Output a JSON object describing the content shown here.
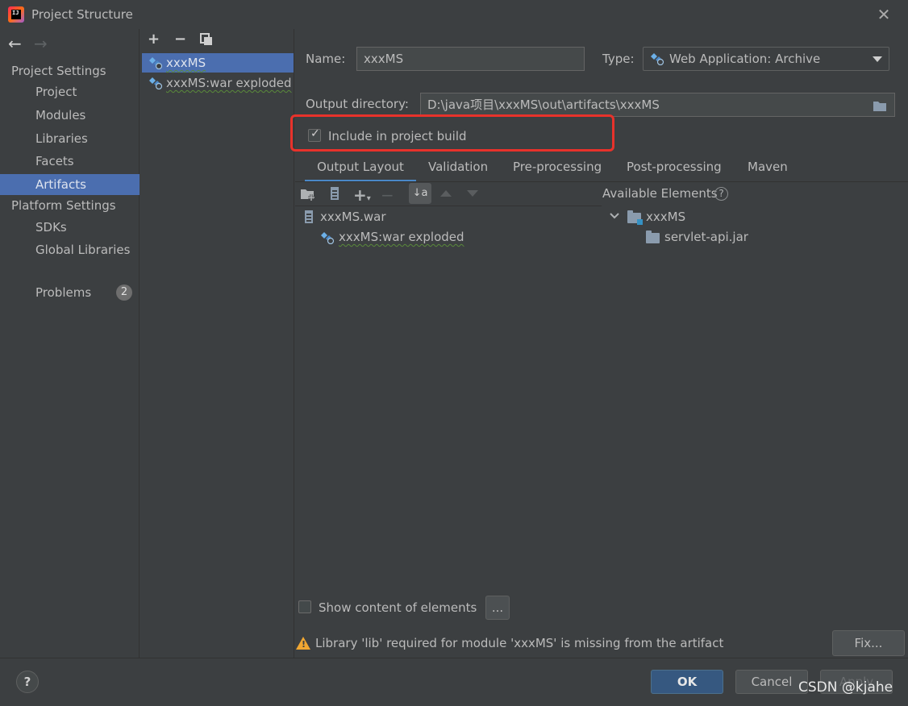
{
  "window": {
    "title": "Project Structure",
    "close_glyph": "✕"
  },
  "nav": {
    "back": "←",
    "forward": "→"
  },
  "sidebar": {
    "project_settings_header": "Project Settings",
    "project_items": [
      "Project",
      "Modules",
      "Libraries",
      "Facets",
      "Artifacts"
    ],
    "platform_settings_header": "Platform Settings",
    "platform_items": [
      "SDKs",
      "Global Libraries"
    ],
    "problems_label": "Problems",
    "problems_count": "2",
    "selected": "Artifacts"
  },
  "artifact_toolbar": {
    "add": "+",
    "remove": "−",
    "copy_icon": "copy-icon"
  },
  "artifacts": [
    {
      "label": "xxxMS",
      "selected": true
    },
    {
      "label": "xxxMS:war exploded",
      "selected": false
    }
  ],
  "form": {
    "name_label": "Name:",
    "name_value": "xxxMS",
    "type_label": "Type:",
    "type_value": "Web Application: Archive",
    "output_dir_label": "Output directory:",
    "output_dir_value": "D:\\java项目\\xxxMS\\out\\artifacts\\xxxMS",
    "include_label": "Include in project build",
    "include_checked": true
  },
  "tabs": [
    {
      "label": "Output Layout",
      "active": true
    },
    {
      "label": "Validation",
      "active": false
    },
    {
      "label": "Pre-processing",
      "active": false
    },
    {
      "label": "Post-processing",
      "active": false
    },
    {
      "label": "Maven",
      "active": false
    }
  ],
  "layout_tree": {
    "root": "xxxMS.war",
    "child": "xxxMS:war exploded"
  },
  "available": {
    "header": "Available Elements",
    "help_glyph": "?",
    "module": "xxxMS",
    "library": "servlet-api.jar"
  },
  "show_content_label": "Show content of elements",
  "ellipsis_button": "...",
  "warning_text": "Library 'lib' required for module 'xxxMS' is missing from the artifact",
  "fix_button": "Fix...",
  "footer": {
    "help": "?",
    "ok": "OK",
    "cancel": "Cancel",
    "apply": "Apply"
  },
  "watermark": "CSDN @kjahe",
  "colors": {
    "accent": "#4b6eaf",
    "background": "#3c3f41",
    "highlight_box": "#e8322b",
    "warning": "#f0a732"
  }
}
